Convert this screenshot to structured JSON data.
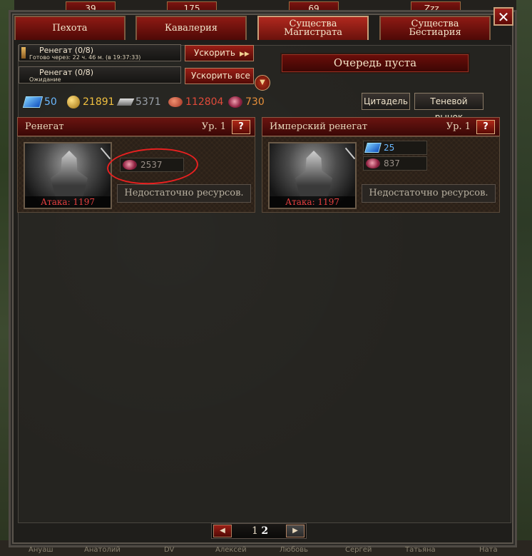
{
  "top_counters": [
    "39",
    "175",
    "69",
    "Zzz..."
  ],
  "tabs": [
    {
      "label": "Пехота",
      "active": false
    },
    {
      "label": "Кавалерия",
      "active": false
    },
    {
      "label_line1": "Существа",
      "label_line2": "Магистрата",
      "active": true
    },
    {
      "label_line1": "Существа",
      "label_line2": "Бестиария",
      "active": false
    }
  ],
  "close_label": "✕",
  "queue": [
    {
      "title": "Ренегат (0/8)",
      "subtitle": "Готово через: 22 ч. 46 м. (в 19:37:33)"
    },
    {
      "title": "Ренегат (0/8)",
      "subtitle": "Ожидание"
    }
  ],
  "speed_buttons": [
    "Ускорить",
    "Ускорить все"
  ],
  "queue_status": "Очередь пуста",
  "resources": {
    "sapphire": "50",
    "gold": "21891",
    "iron": "5371",
    "meat": "112804",
    "blood": "730"
  },
  "resource_colors": {
    "sapphire": "#6ab8ff",
    "gold": "#f0c040",
    "iron": "#9aa0a8",
    "meat": "#e04a3a",
    "blood": "#e8903a"
  },
  "buttons": {
    "citadel": "Цитадель",
    "shadow_market": "Теневой рынок"
  },
  "cards": [
    {
      "name": "Ренегат",
      "level": "Ур. 1",
      "help": "?",
      "attack": "Атака: 1197",
      "costs": [
        {
          "type": "blood",
          "value": "2537"
        }
      ],
      "status": "Недостаточно ресурсов."
    },
    {
      "name": "Имперский ренегат",
      "level": "Ур. 1",
      "help": "?",
      "attack": "Атака: 1197",
      "costs": [
        {
          "type": "sapphire",
          "value": "25"
        },
        {
          "type": "blood",
          "value": "837"
        }
      ],
      "status": "Недостаточно ресурсов."
    }
  ],
  "pager": {
    "page1": "1",
    "page2": "2"
  },
  "bottom_names": [
    "Ануаш",
    "Анатолий",
    "DV",
    "Алексей",
    "Любовь",
    "Сергей",
    "Татьяна",
    "Ната"
  ]
}
